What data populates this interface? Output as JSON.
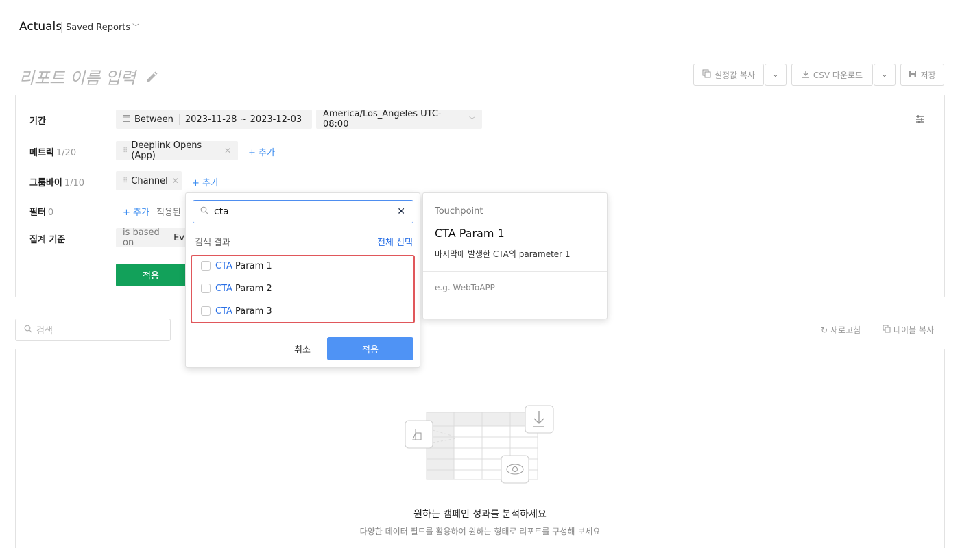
{
  "header": {
    "title": "Actuals",
    "saved_reports": "Saved Reports",
    "report_name_placeholder": "리포트 이름 입력"
  },
  "toolbar": {
    "copy_settings": "설정값 복사",
    "csv_download": "CSV 다운로드",
    "save": "저장"
  },
  "settings": {
    "period": {
      "label": "기간",
      "mode": "Between",
      "range": "2023-11-28 ~ 2023-12-03",
      "timezone": "America/Los_Angeles UTC-08:00"
    },
    "metrics": {
      "label": "메트릭",
      "count": "1/20",
      "chip": "Deeplink Opens (App)",
      "add": "+ 추가"
    },
    "groupby": {
      "label": "그룹바이",
      "count": "1/10",
      "chip": "Channel",
      "add": "+ 추가"
    },
    "filter": {
      "label": "필터",
      "count": "0",
      "add": "+ 추가",
      "applied_partial": "적용된 "
    },
    "aggregation": {
      "label": "집계 기준",
      "prefix": "is based on",
      "value_partial": "Ev"
    },
    "apply": "적용"
  },
  "dropdown": {
    "search_value": "cta",
    "results_label": "검색 결과",
    "select_all": "전체 선택",
    "items": [
      {
        "highlight": "CTA",
        "rest": " Param 1"
      },
      {
        "highlight": "CTA",
        "rest": " Param 2"
      },
      {
        "highlight": "CTA",
        "rest": " Param 3"
      }
    ],
    "cancel": "취소",
    "apply": "적용"
  },
  "tooltip": {
    "category": "Touchpoint",
    "title": "CTA Param 1",
    "description": "마지막에 발생한 CTA의 parameter 1",
    "example": "e.g. WebToAPP"
  },
  "table_bar": {
    "search_placeholder": "검색",
    "refresh": "새로고침",
    "copy_table": "테이블 복사"
  },
  "empty_state": {
    "title": "원하는 캠페인 성과를 분석하세요",
    "subtitle": "다양한 데이터 필드를 활용하여 원하는 형태로 리포트를 구성해 보세요"
  },
  "colors": {
    "apply_green": "#12a15a",
    "apply_blue": "#4f93f5",
    "link_blue": "#3b8cf0",
    "highlight_red": "#e0575b"
  }
}
